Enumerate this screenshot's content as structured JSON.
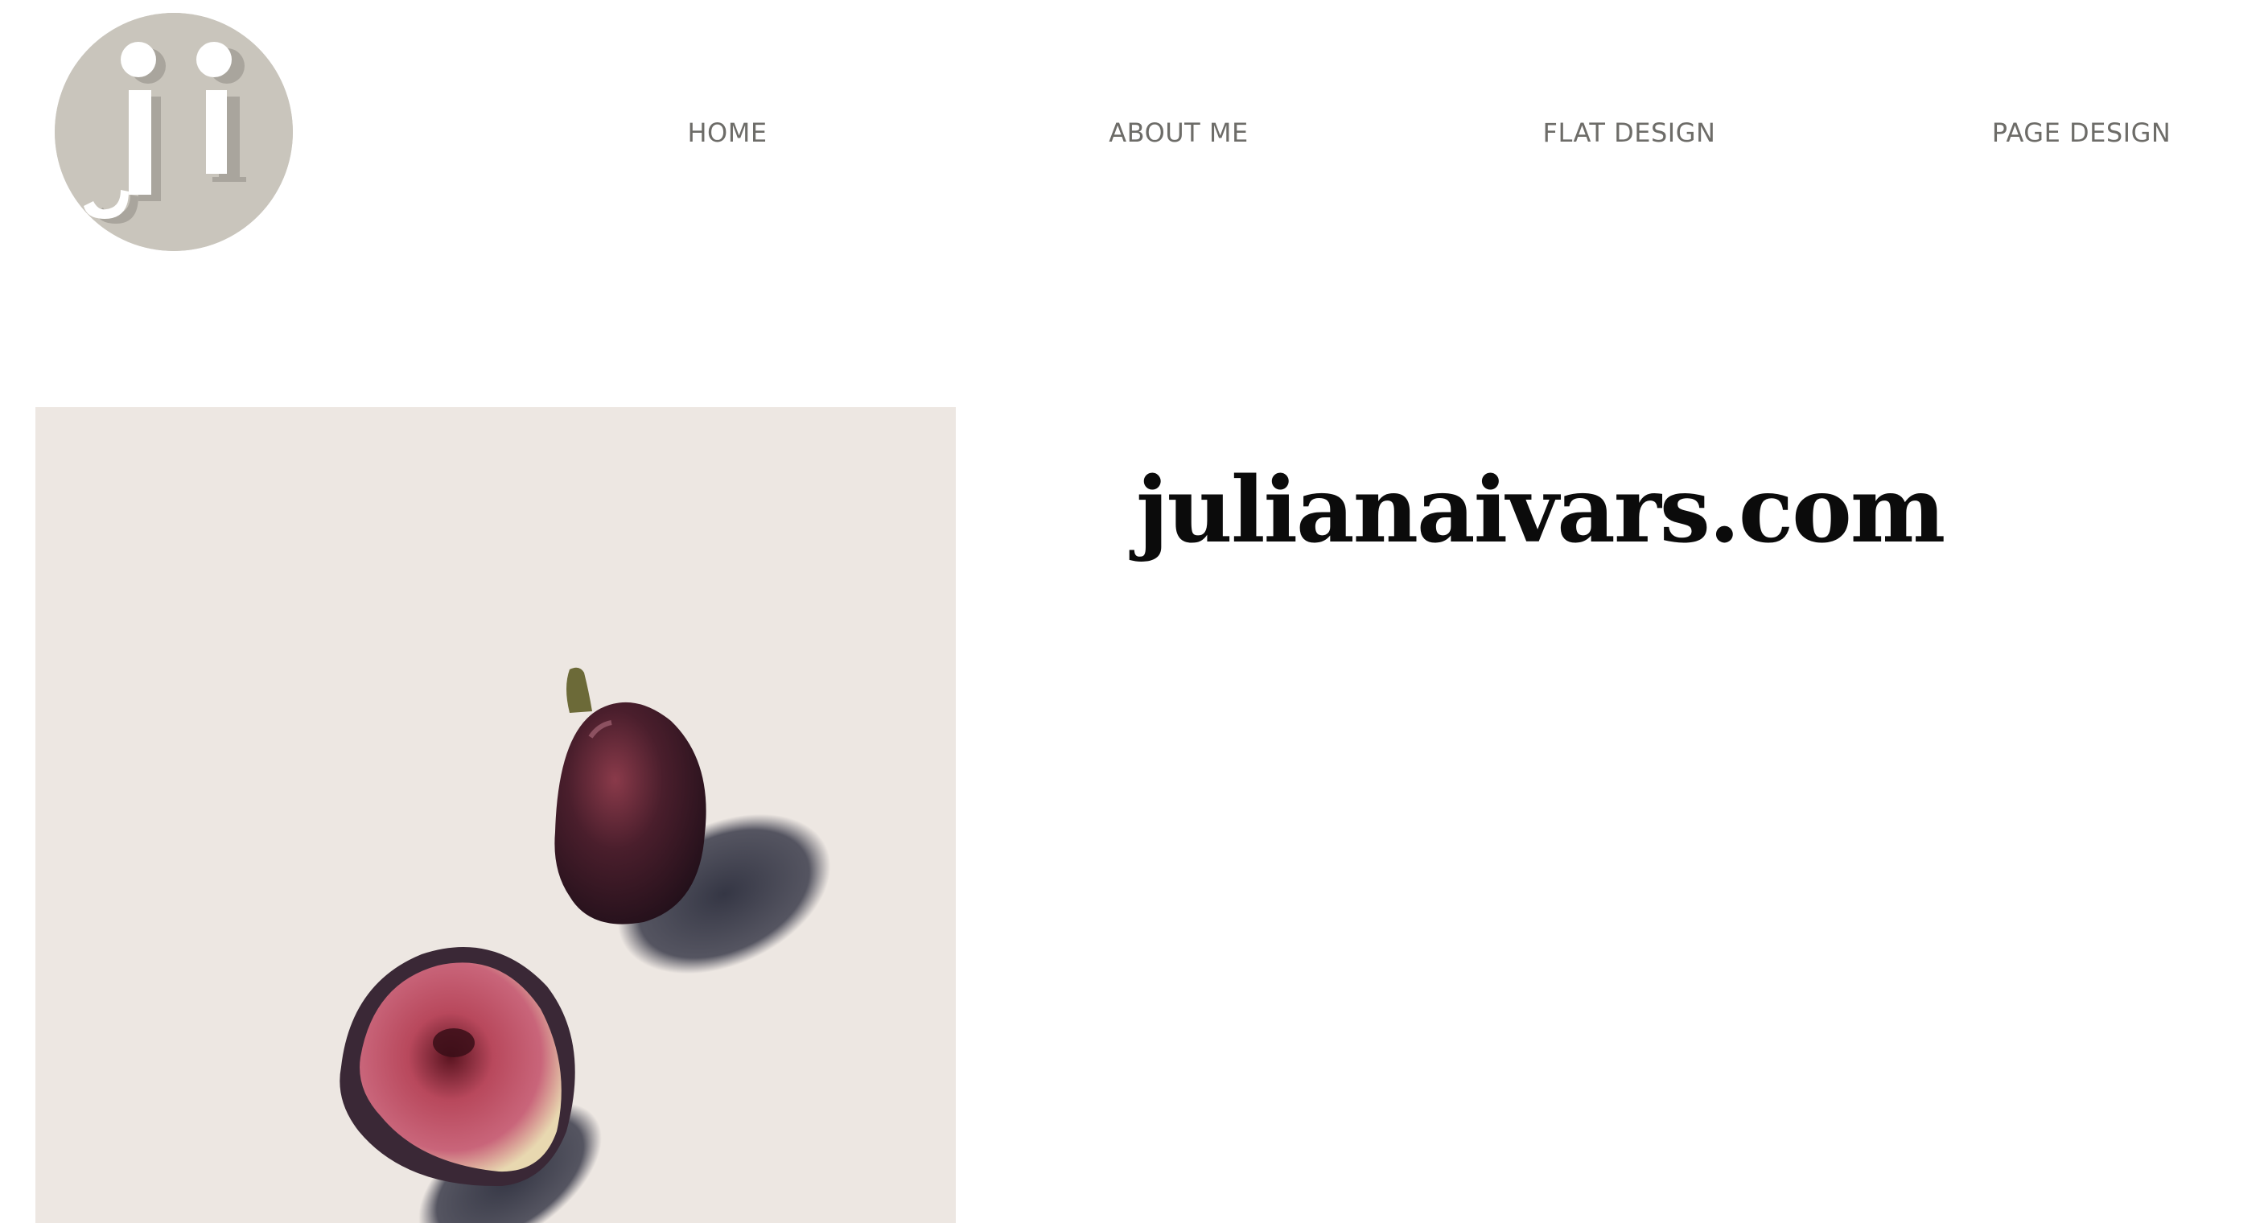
{
  "logo": {
    "text": "ji",
    "icon": "monogram-logo-icon",
    "color": "#c9c5bc"
  },
  "nav": {
    "items": [
      {
        "label": "HOME"
      },
      {
        "label": "ABOUT ME"
      },
      {
        "label": "FLAT DESIGN"
      },
      {
        "label": "PAGE DESIGN"
      }
    ],
    "color": "#6d6c68"
  },
  "hero": {
    "image": "figs-photo",
    "title": "julianaivars.com",
    "background": "#ede7e2"
  }
}
